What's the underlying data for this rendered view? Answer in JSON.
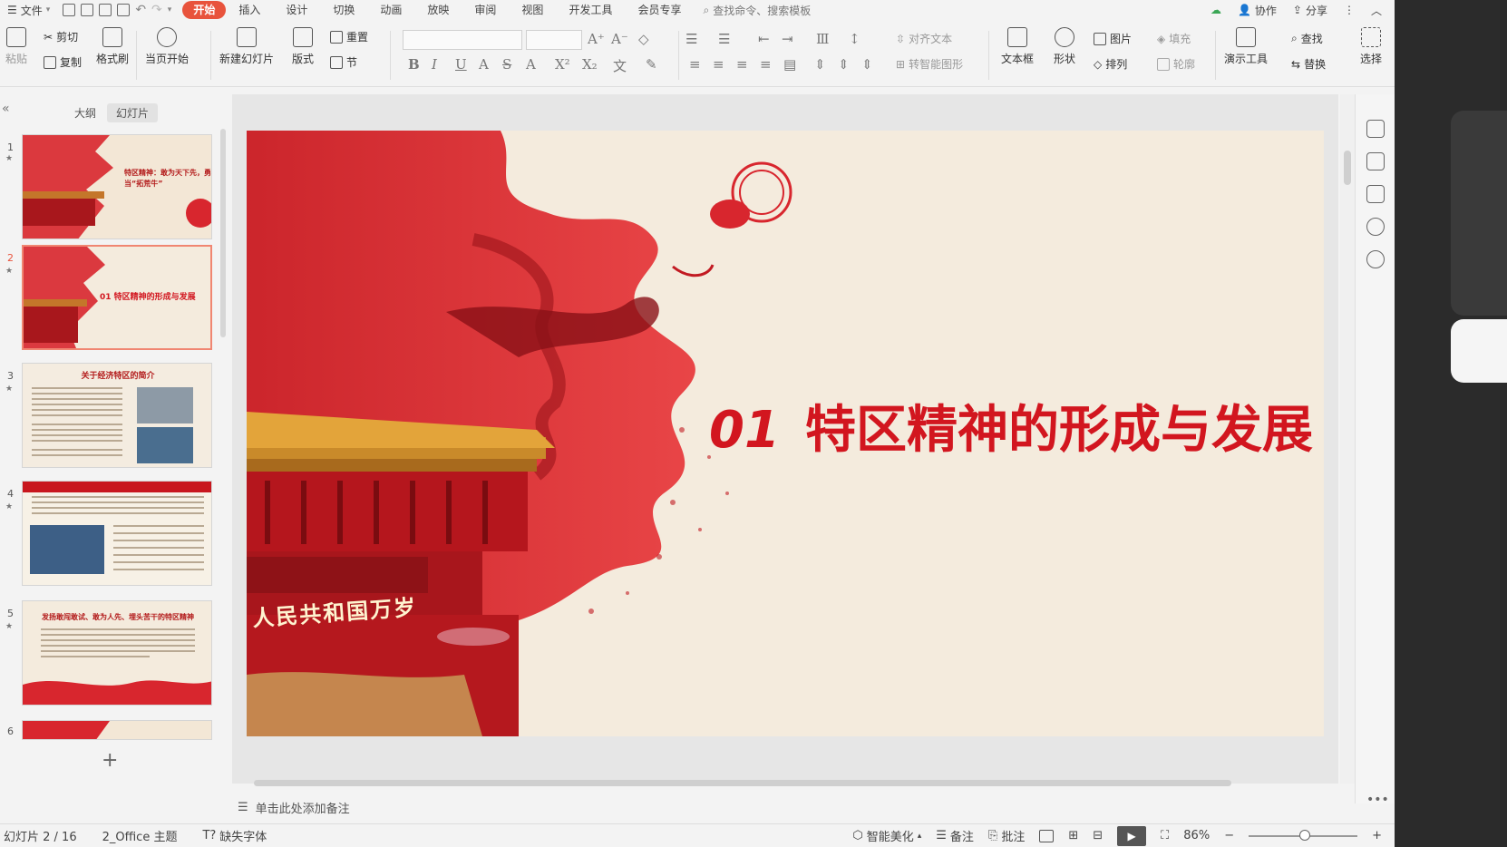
{
  "menu": {
    "file_label": "文件",
    "tabs": [
      "开始",
      "插入",
      "设计",
      "切换",
      "动画",
      "放映",
      "审阅",
      "视图",
      "开发工具",
      "会员专享"
    ],
    "active_tab": "开始",
    "search_label": "查找命令、搜索模板",
    "collab_label": "协作",
    "share_label": "分享"
  },
  "ribbon": {
    "paste": "粘贴",
    "cut": "剪切",
    "copy": "复制",
    "format_painter": "格式刷",
    "play_current": "当页开始",
    "new_slide": "新建幻灯片",
    "layout": "版式",
    "reset": "重置",
    "section": "节",
    "align_text": "对齐文本",
    "smart_art": "转智能图形",
    "text_box": "文本框",
    "shape": "形状",
    "picture": "图片",
    "fill": "填充",
    "arrange": "排列",
    "outline": "轮廓",
    "presentation_tools": "演示工具",
    "find": "查找",
    "replace": "替换",
    "select": "选择"
  },
  "left_panel": {
    "tab_outline": "大纲",
    "tab_slides": "幻灯片",
    "thumbs": [
      {
        "num": "1",
        "title": "特区精神：敢为天下先，勇当“拓荒牛”"
      },
      {
        "num": "2",
        "title": "01 特区精神的形成与发展"
      },
      {
        "num": "3",
        "title": "关于经济特区的简介"
      },
      {
        "num": "4",
        "title": ""
      },
      {
        "num": "5",
        "title": "发扬敢闯敢试、敢为人先、埋头苦干的特区精神"
      },
      {
        "num": "6",
        "title": ""
      }
    ]
  },
  "slide": {
    "number": "01",
    "title": "特区精神的形成与发展",
    "banner_text": "人民共和国万岁"
  },
  "notes_placeholder": "单击此处添加备注",
  "status": {
    "slide_info": "幻灯片 2 / 16",
    "theme": "2_Office 主题",
    "missing_font": "缺失字体",
    "beautify": "智能美化",
    "notes": "备注",
    "comments": "批注",
    "zoom": "86%"
  },
  "colors": {
    "accent": "#e8533c",
    "title_red": "#d2161f"
  }
}
